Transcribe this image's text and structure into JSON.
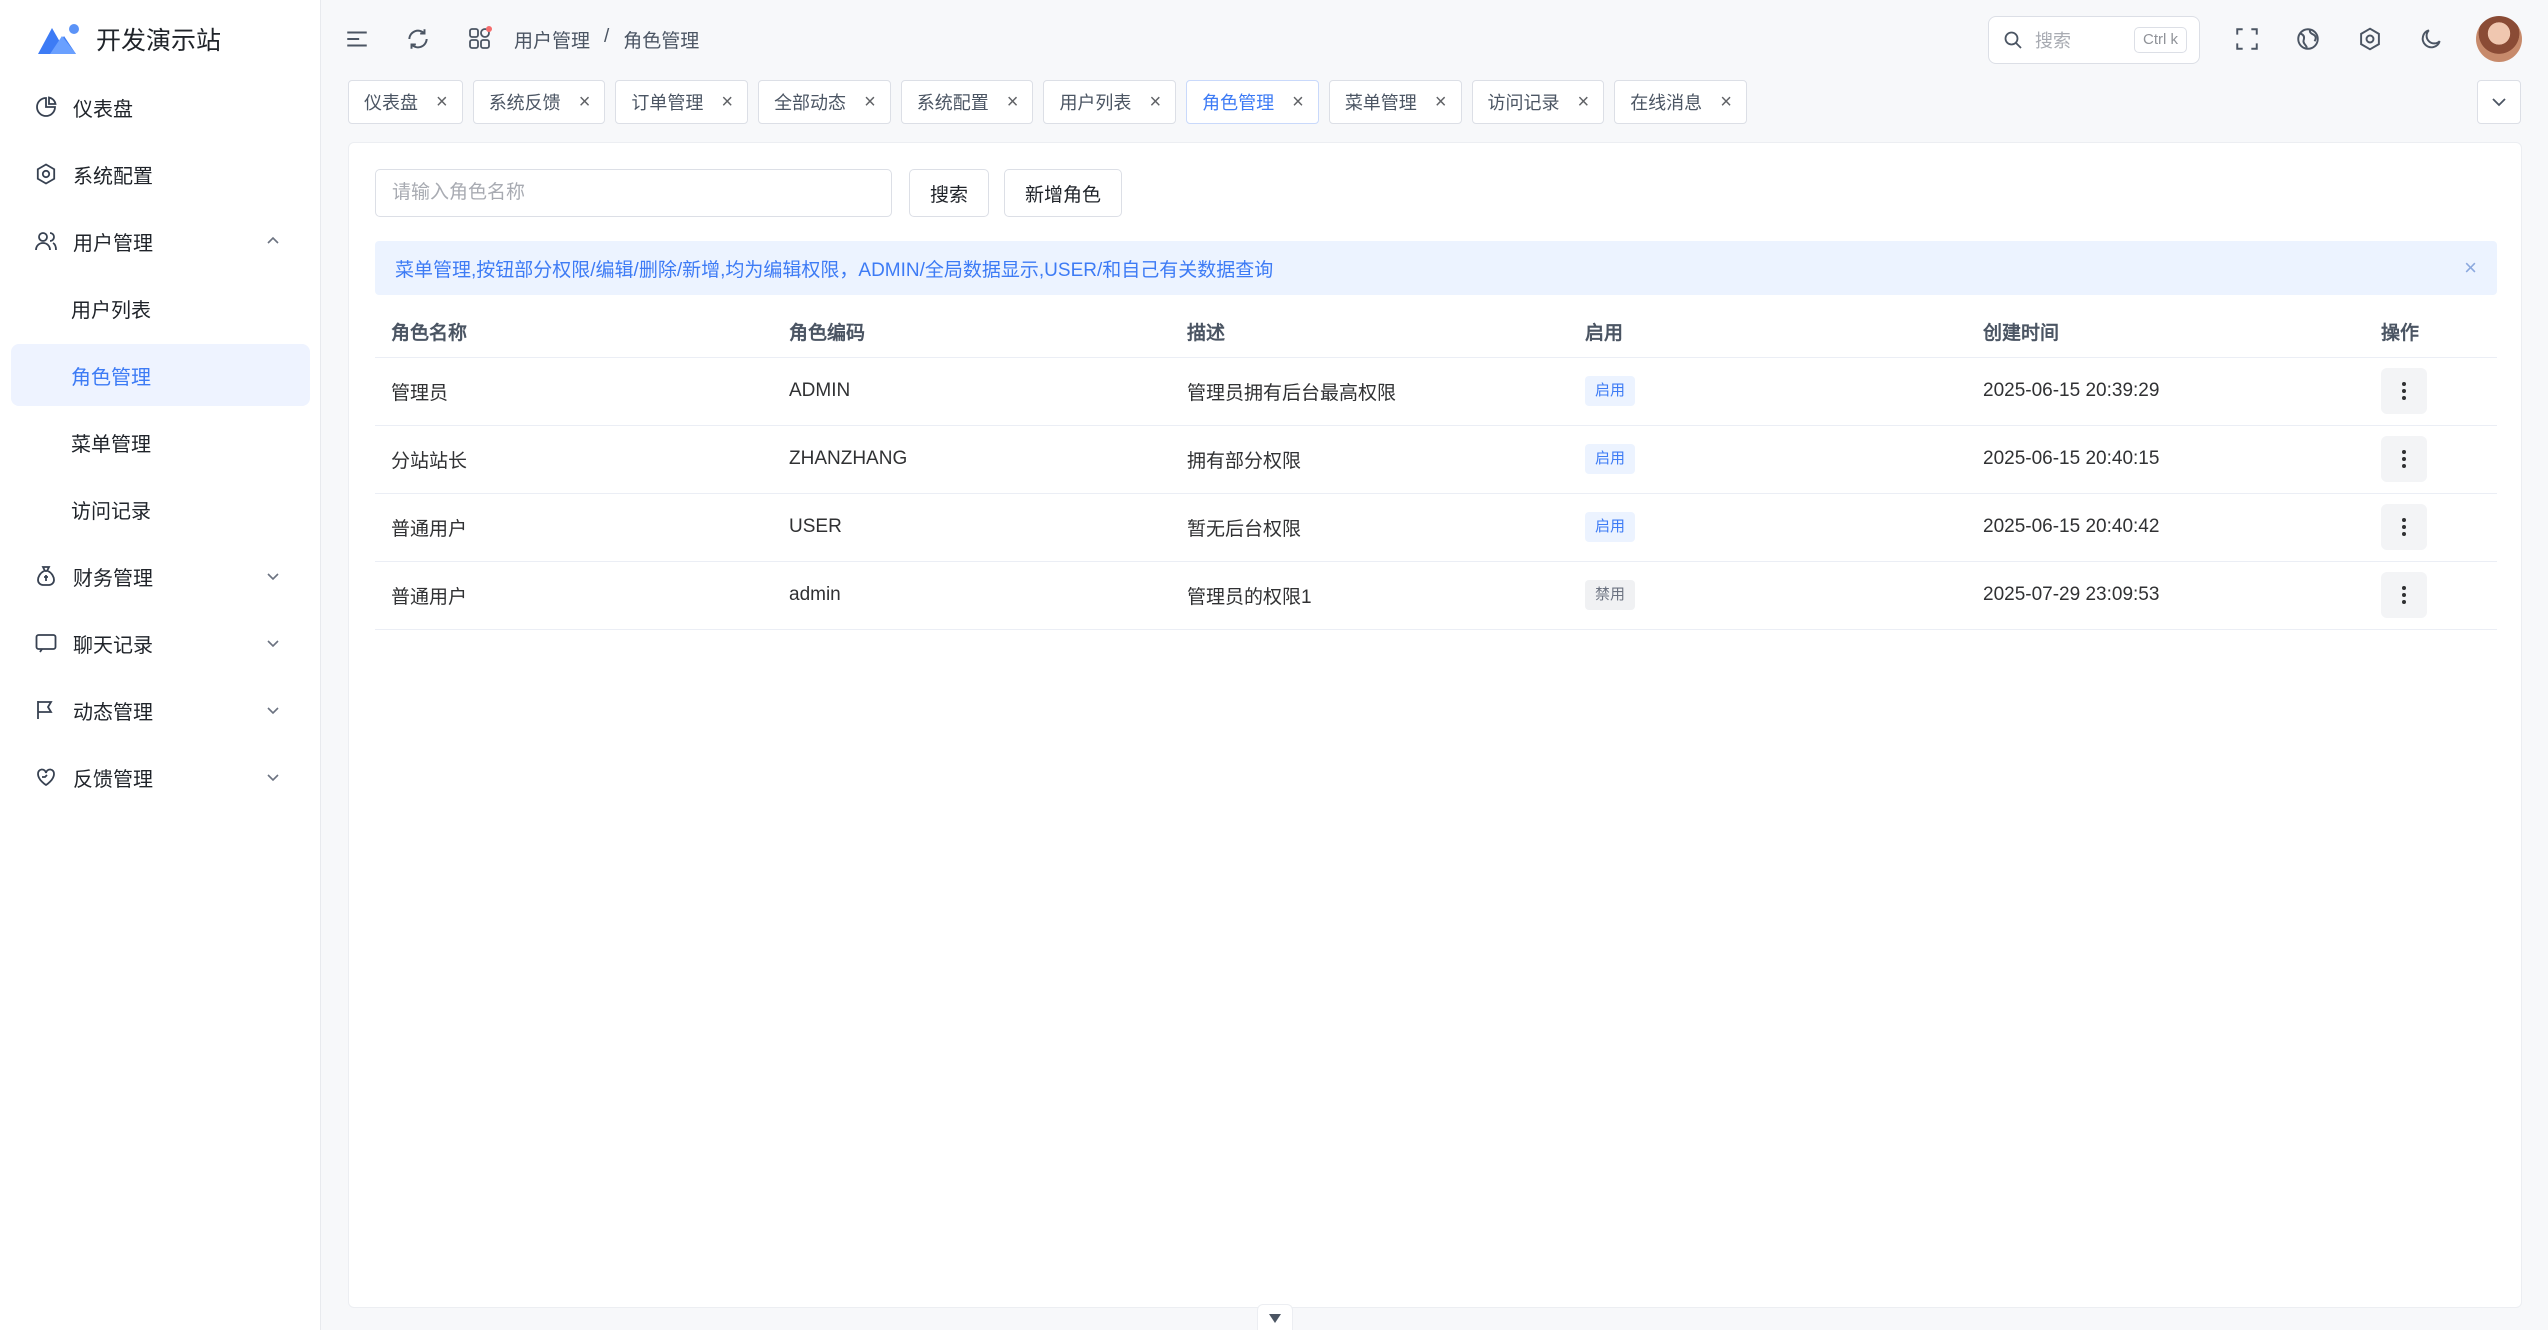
{
  "app": {
    "title": "开发演示站",
    "logo_icon": "mountain-logo"
  },
  "sidebar": {
    "items": [
      {
        "label": "仪表盘",
        "icon": "pie-chart-icon"
      },
      {
        "label": "系统配置",
        "icon": "gear-icon"
      },
      {
        "label": "用户管理",
        "icon": "users-icon",
        "expanded": true
      },
      {
        "label": "用户列表"
      },
      {
        "label": "角色管理",
        "active": true
      },
      {
        "label": "菜单管理"
      },
      {
        "label": "访问记录"
      },
      {
        "label": "财务管理",
        "icon": "money-bag-icon"
      },
      {
        "label": "聊天记录",
        "icon": "chat-icon"
      },
      {
        "label": "动态管理",
        "icon": "flag-icon"
      },
      {
        "label": "反馈管理",
        "icon": "heart-hand-icon"
      }
    ]
  },
  "header": {
    "breadcrumb": [
      "用户管理",
      "/",
      "角色管理"
    ],
    "search_placeholder": "搜索",
    "search_shortcut": "Ctrl k",
    "notification_color": "#f56c6c"
  },
  "tabs": [
    {
      "label": "仪表盘"
    },
    {
      "label": "系统反馈"
    },
    {
      "label": "订单管理"
    },
    {
      "label": "全部动态"
    },
    {
      "label": "系统配置"
    },
    {
      "label": "用户列表"
    },
    {
      "label": "角色管理",
      "active": true
    },
    {
      "label": "菜单管理"
    },
    {
      "label": "访问记录"
    },
    {
      "label": "在线消息"
    }
  ],
  "filter": {
    "placeholder": "请输入角色名称",
    "search_label": "搜索",
    "add_label": "新增角色"
  },
  "alert": {
    "text": "菜单管理,按钮部分权限/编辑/删除/新增,均为编辑权限，ADMIN/全局数据显示,USER/和自己有关数据查询"
  },
  "table": {
    "columns": [
      "角色名称",
      "角色编码",
      "描述",
      "启用",
      "创建时间",
      "操作"
    ],
    "rows": [
      {
        "name": "管理员",
        "code": "ADMIN",
        "desc": "管理员拥有后台最高权限",
        "status": "启用",
        "time": "2025-06-15 20:39:29"
      },
      {
        "name": "分站站长",
        "code": "ZHANZHANG",
        "desc": "拥有部分权限",
        "status": "启用",
        "time": "2025-06-15 20:40:15"
      },
      {
        "name": "普通用户",
        "code": "USER",
        "desc": "暂无后台权限",
        "status": "启用",
        "time": "2025-06-15 20:40:42"
      },
      {
        "name": "普通用户",
        "code": "admin",
        "desc": "管理员的权限1",
        "status": "禁用",
        "time": "2025-07-29 23:09:53"
      }
    ]
  },
  "colors": {
    "accent": "#3d7bf5",
    "active_bg": "#eef3ff"
  }
}
